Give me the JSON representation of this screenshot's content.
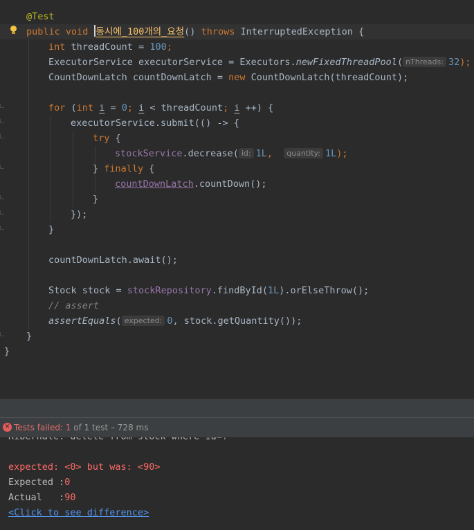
{
  "editor": {
    "annotation": "@Test",
    "kw_public": "public",
    "kw_void": "void",
    "method_name": "동시에_100개의_요청",
    "method_parens": "()",
    "kw_throws": "throws",
    "exception_type": "InterruptedException {",
    "l3_kw": "int",
    "l3_text": "threadCount = ",
    "l3_num": "100",
    "l3_end": ";",
    "l4_text": "ExecutorService executorService = Executors.",
    "l4_method": "newFixedThreadPool",
    "l4_paren": "(",
    "l4_hint": "nThreads:",
    "l4_num": "32",
    "l4_end": ");",
    "l5_text": "CountDownLatch countDownLatch = ",
    "l5_kw": "new",
    "l5_rest": "CountDownLatch(threadCount);",
    "for_kw": "for",
    "for_open": "(",
    "for_int": "int",
    "for_i1": "i",
    "for_eq": " = ",
    "for_zero": "0",
    "for_semi1": "; ",
    "for_i2": "i",
    "for_cond": " < threadCount",
    "for_semi2": "; ",
    "for_i3": "i",
    "for_inc": " ++) {",
    "submit_line": "executorService.submit(() -> {",
    "try_kw": "try",
    "try_brace": " {",
    "stock_service": "stockService",
    "decrease_call": ".decrease(",
    "hint_id": "id:",
    "id_val": "1L",
    "comma": ",",
    "hint_quantity": "quantity:",
    "qty_val": "1L",
    "decrease_end": ");",
    "finally_close": "} ",
    "finally_kw": "finally",
    "finally_brace": " {",
    "latch_field": "countDownLatch",
    "countdown_call": ".countDown();",
    "close_brace_inner": "}",
    "submit_close": "});",
    "for_close": "}",
    "await_line": "countDownLatch.await();",
    "stock_decl": "Stock stock = ",
    "stock_repo": "stockRepository",
    "find_call": ".findById(",
    "find_arg": "1L",
    "find_end": ").orElseThrow();",
    "comment": "// assert",
    "assert_method": "assertEquals",
    "assert_paren": "(",
    "hint_expected": "expected:",
    "assert_zero": "0",
    "assert_rest": ", stock.getQuantity());",
    "method_close": "}",
    "class_close": "}"
  },
  "status": {
    "label": "Tests failed:",
    "count": "1",
    "of_text": "of 1 test – 728 ms"
  },
  "console": {
    "cut_line": "Hibernate: delete from stock where id=?",
    "message": "expected: <0> but was: <90>",
    "expected_label": "Expected :",
    "expected_value": "0",
    "actual_label": "Actual   :",
    "actual_value": "90",
    "diff_link": "<Click to see difference>"
  }
}
